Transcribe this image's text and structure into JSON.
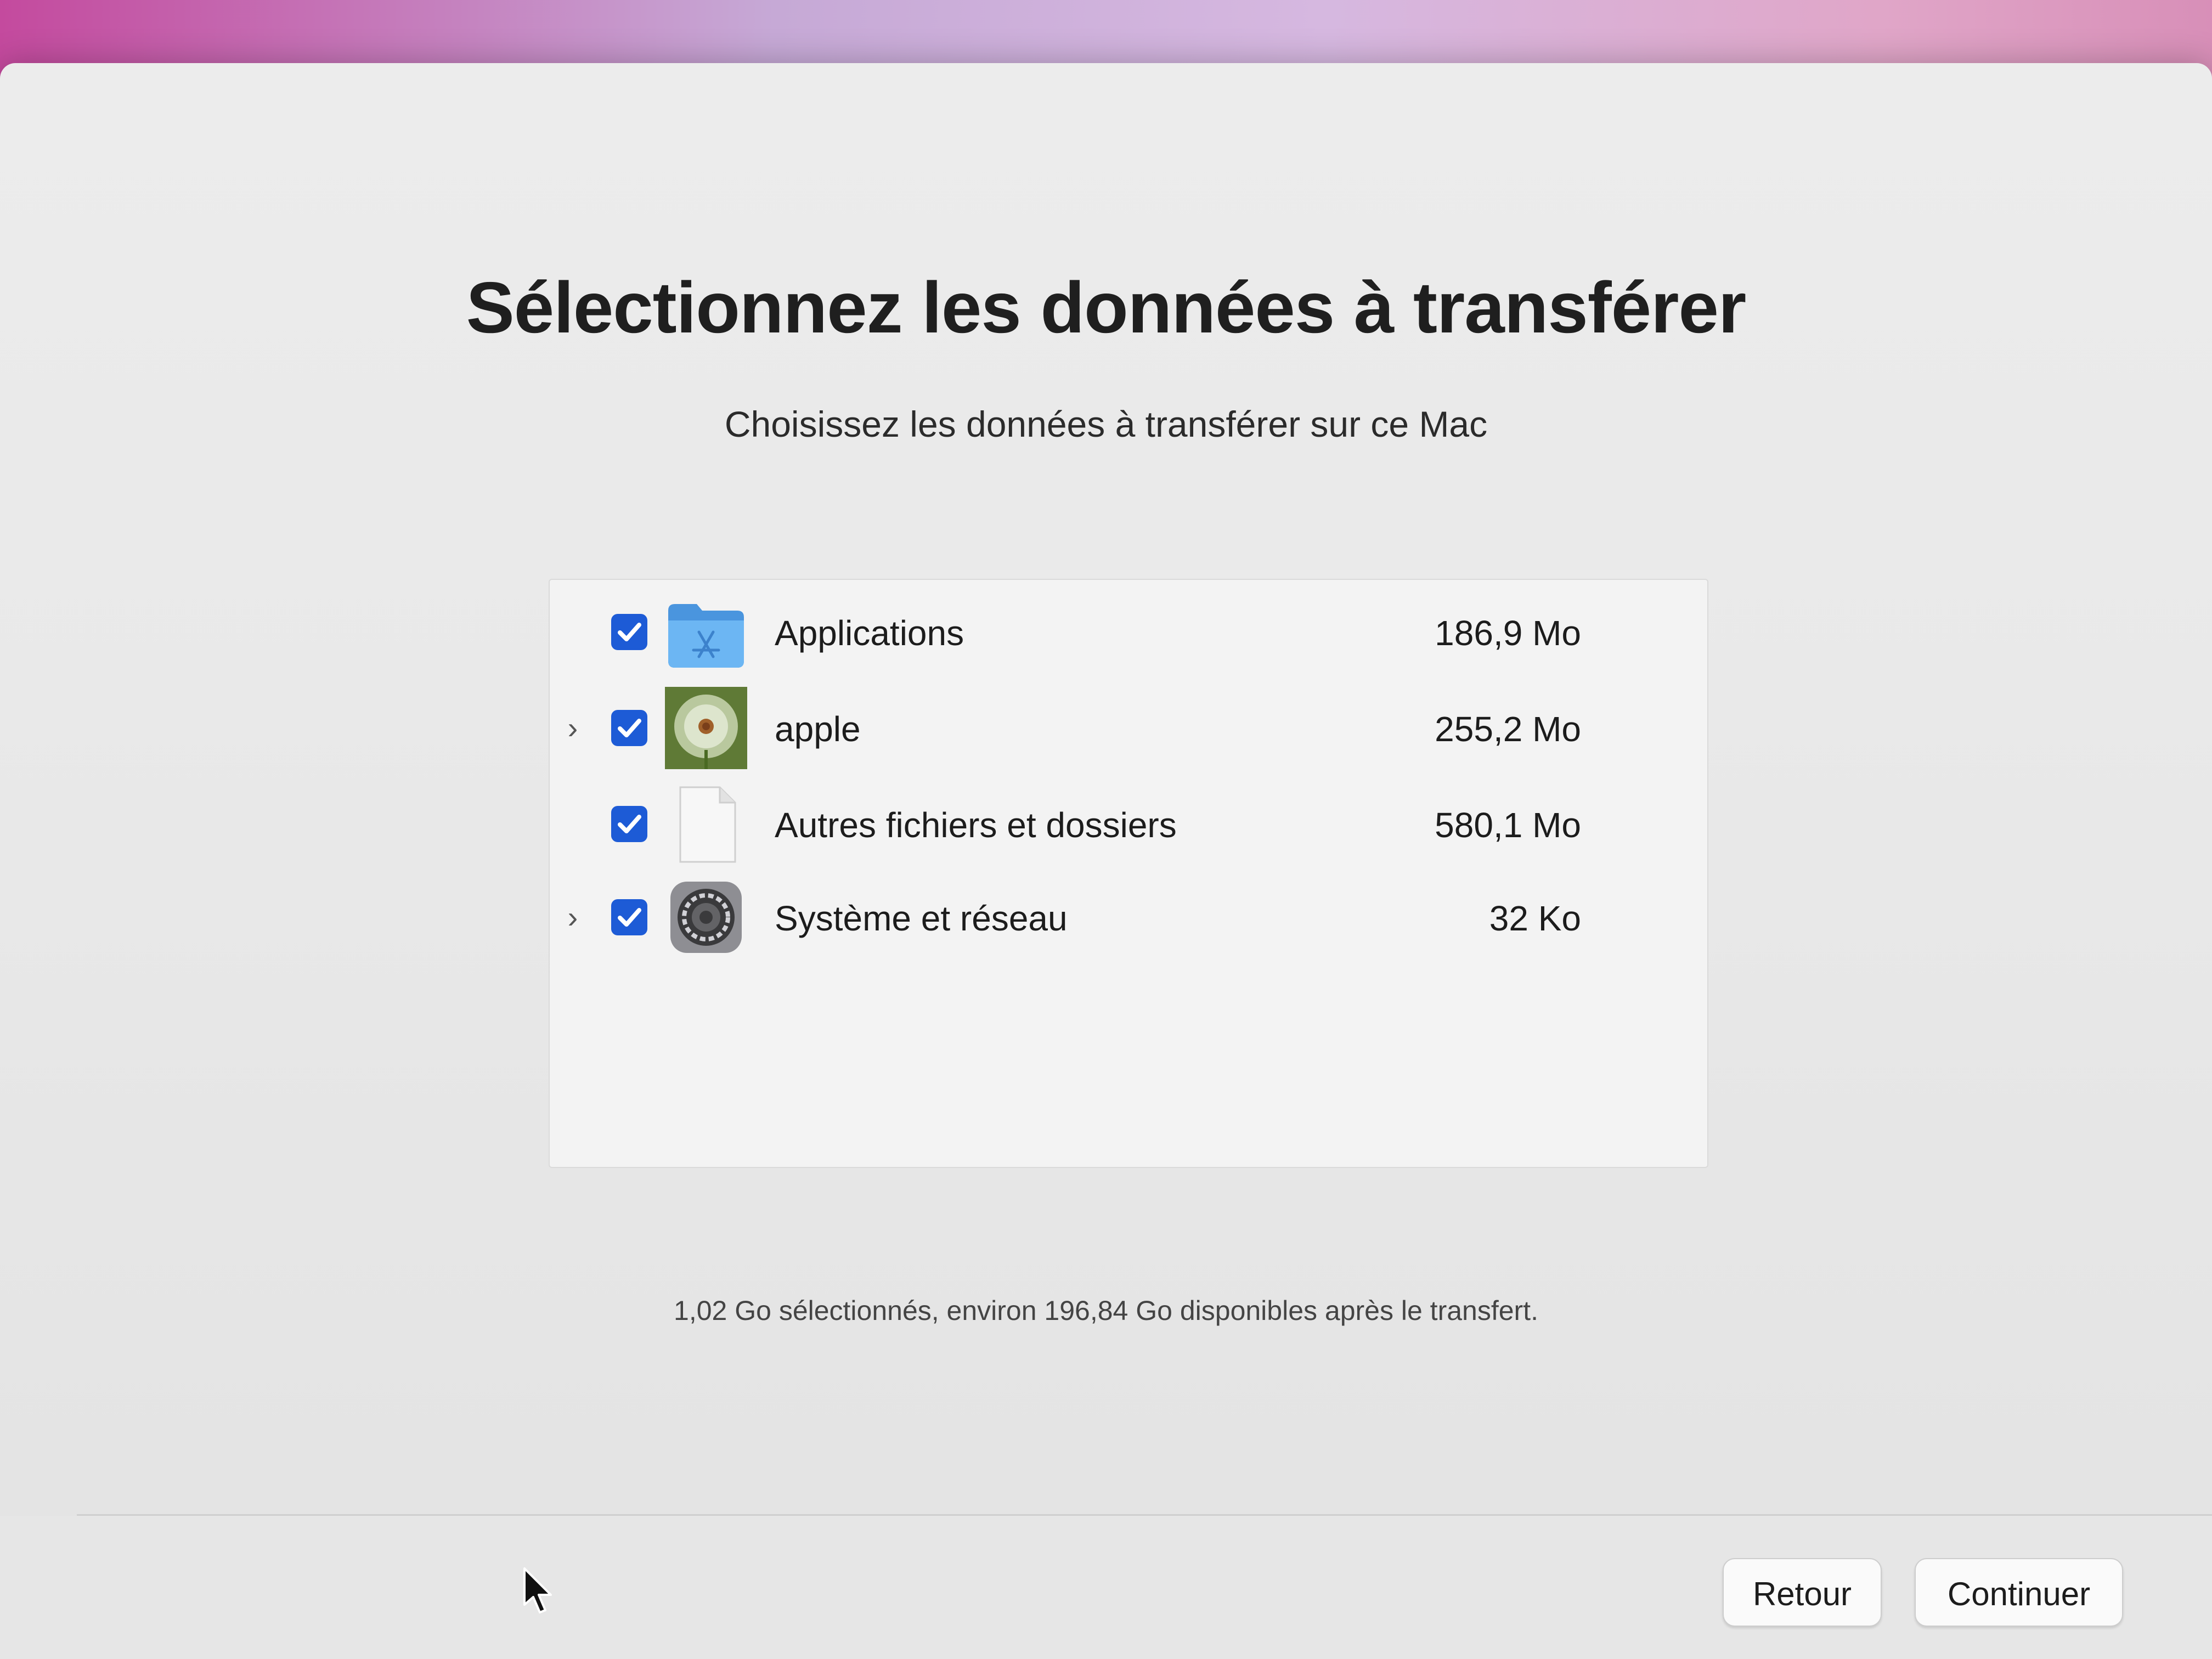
{
  "screen": {
    "title": "Sélectionnez les données à transférer",
    "subtitle": "Choisissez les données à transférer sur ce Mac"
  },
  "items": [
    {
      "label": "Applications",
      "size": "186,9 Mo",
      "checked": true,
      "expandable": false,
      "icon": "applications-folder-icon"
    },
    {
      "label": "apple",
      "size": "255,2 Mo",
      "checked": true,
      "expandable": true,
      "icon": "user-avatar-dandelion"
    },
    {
      "label": "Autres fichiers et dossiers",
      "size": "580,1 Mo",
      "checked": true,
      "expandable": false,
      "icon": "document-icon"
    },
    {
      "label": "Système et réseau",
      "size": "32 Ko",
      "checked": true,
      "expandable": true,
      "icon": "system-settings-gear-icon"
    }
  ],
  "summary": "1,02 Go sélectionnés, environ 196,84 Go disponibles après le transfert.",
  "buttons": {
    "back": "Retour",
    "continue": "Continuer"
  },
  "colors": {
    "checkbox": "#1d5bd6",
    "window_background": "#ececec",
    "folder_blue": "#5aa9ef"
  }
}
